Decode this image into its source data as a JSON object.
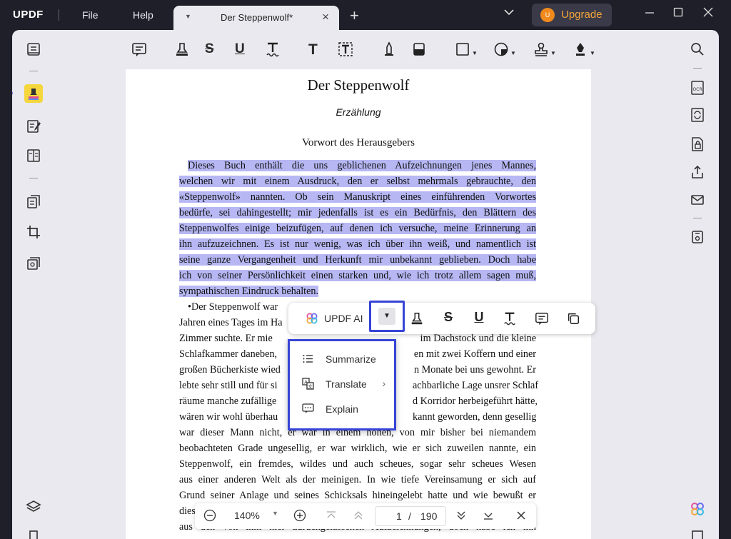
{
  "app": {
    "logo": "UPDF"
  },
  "menu": {
    "file": "File",
    "help": "Help"
  },
  "tab": {
    "title": "Der Steppenwolf*"
  },
  "upgrade": {
    "label": "Upgrade",
    "coin": "U"
  },
  "document": {
    "title": "Der Steppenwolf",
    "subtitle": "Erzählung",
    "heading": "Vorwort des Herausgebers",
    "para1": [
      "Dieses Buch enthält die uns geblichenen Aufzeichnungen jenes Mannes,",
      "welchen wir mit einem Ausdruck, den er selbst mehrmals gebrauchte, den",
      "«Steppenwolf» nannten. Ob sein Manuskript eines einführenden Vorwortes",
      "bedürfe, sei dahingestellt; mir jedenfalls ist es ein Bedürfnis, den Blättern des",
      "Steppenwolfes einige beizufügen, auf denen ich versuche, meine Erinnerung an",
      "ihn aufzuzeichnen. Es ist nur wenig, was ich über ihn weiß, und namentlich ist",
      "seine ganze Vergangenheit und Herkunft mir unbekannt geblieben. Doch habe",
      "ich von seiner Persönlichkeit einen starken und, wie ich trotz allem sagen muß,",
      "sympathischen Eindruck behalten."
    ],
    "para2": [
      "•Der Steppenwolf war",
      "Jahren eines Tages im Ha",
      "Zimmer suchte. Er mie",
      "Schlafkammer daneben,",
      "großen Bücherkiste wied",
      "lebte sehr still und für si",
      "räume manche zufällige",
      "wären wir wohl überhau",
      "war dieser Mann nicht, er war in einem hohen, von mir bisher bei niemandem",
      "beobachteten Grade ungesellig, er war wirklich, wie er sich zuweilen nannte, ein",
      "Steppenwolf, ein fremdes, wildes und auch scheues, sogar sehr scheues Wesen",
      "aus einer anderen Welt als der meinigen. In wie tiefe Vereinsamung er sich auf",
      "Grund seiner Anlage und seines Schicksals hineingelebt hatte und wie bewußt er",
      "dies"
    ],
    "para2_right": [
      "",
      "",
      "im Dachstock und die kleine",
      "en mit zwei Koffern und einer",
      "n Monate bei uns gewohnt. Er",
      "achbarliche Lage unsrer Schlaf",
      "d Korridor herbeigeführt hätte,",
      "kannt geworden, denn gesellig"
    ],
    "partial_bottom": "aus den von ihm hier zurückgelassenen Aufzeichnungen, doch habe ich ihn"
  },
  "floating_toolbar": {
    "ai_label": "UPDF AI"
  },
  "ai_menu": {
    "items": [
      {
        "label": "Summarize",
        "icon": "list-icon"
      },
      {
        "label": "Translate",
        "icon": "translate-icon"
      },
      {
        "label": "Explain",
        "icon": "explain-icon"
      }
    ]
  },
  "navigation": {
    "zoom": "140%",
    "current_page": "1",
    "separator": "/",
    "total_pages": "190"
  }
}
